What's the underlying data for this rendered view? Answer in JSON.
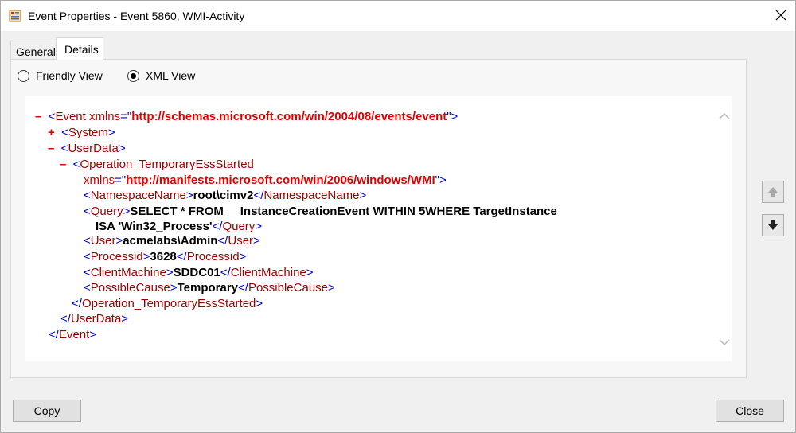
{
  "window": {
    "title": "Event Properties - Event 5860, WMI-Activity"
  },
  "tabs": [
    {
      "label": "General",
      "selected": false
    },
    {
      "label": "Details",
      "selected": true
    }
  ],
  "view_options": {
    "friendly_view": {
      "label": "Friendly View",
      "checked": false
    },
    "xml_view": {
      "label": "XML View",
      "checked": true
    }
  },
  "xml": {
    "event_toggle": "–",
    "event_open_tag": "Event",
    "event_attr": "xmlns",
    "event_ns": "http://schemas.microsoft.com/win/2004/08/events/event",
    "system_toggle": "+",
    "system_tag": "System",
    "userdata_toggle": "–",
    "userdata_tag": "UserData",
    "op_toggle": "–",
    "op_tag": "Operation_TemporaryEssStarted",
    "op_attr": "xmlns",
    "op_ns": "http://manifests.microsoft.com/win/2006/windows/WMI",
    "namespace_tag": "NamespaceName",
    "namespace_value": "root\\cimv2",
    "query_tag": "Query",
    "query_value_line1": "SELECT * FROM __InstanceCreationEvent WITHIN 5WHERE TargetInstance",
    "query_value_line2": "ISA 'Win32_Process'",
    "user_tag": "User",
    "user_value": "acmelabs\\Admin",
    "processid_tag": "Processid",
    "processid_value": "3628",
    "clientmachine_tag": "ClientMachine",
    "clientmachine_value": "SDDC01",
    "possiblecause_tag": "PossibleCause",
    "possiblecause_value": "Temporary"
  },
  "buttons": {
    "copy": "Copy",
    "close": "Close"
  },
  "icons": {
    "app": "event-viewer-icon",
    "close": "close-icon",
    "scroll_up": "chevron-up-icon",
    "scroll_down": "chevron-down-icon",
    "prev_event": "arrow-up-icon",
    "next_event": "arrow-down-icon"
  }
}
